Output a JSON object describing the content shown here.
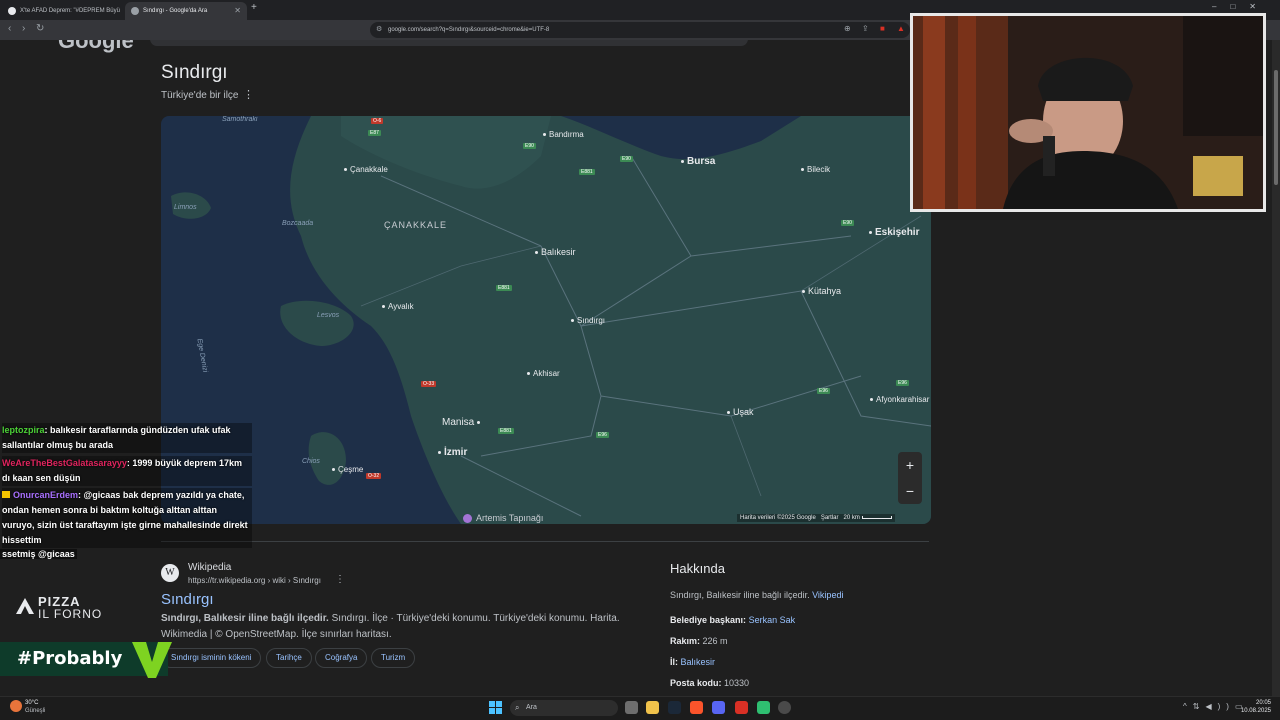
{
  "browser": {
    "tabs": [
      {
        "label": "X'te AFAD Deprem: \"#DEPREM Büyü",
        "active": false
      },
      {
        "label": "Sındırgı - Google'da Ara",
        "active": true
      }
    ],
    "new_tab": "+",
    "url": "google.com/search?q=Sındırgı&sourceid=chrome&ie=UTF-8"
  },
  "page": {
    "logo_text": "Google",
    "knowledge_panel": {
      "title": "Sındırgı",
      "subtitle": "Türkiye'de bir ilçe"
    },
    "map": {
      "cities": [
        "Bandırma",
        "Bursa",
        "Bilecik",
        "Çanakkale",
        "Balıkesir",
        "Eskişehir",
        "Ayvalık",
        "Sındırgı",
        "Kütahya",
        "Akhisar",
        "Manisa",
        "İzmir",
        "Uşak",
        "Afyonkarahisar",
        "Çeşme",
        "Artemis Tapınağı"
      ],
      "regions": [
        "ÇANAKKALE"
      ],
      "seas": [
        "Samothraki",
        "Limnos",
        "Bozcaada",
        "Lesvos",
        "Ege Denizi",
        "Chios"
      ],
      "roads": [
        "O-6",
        "E87",
        "E90",
        "E90",
        "E881",
        "E90",
        "E881",
        "O-33",
        "E881",
        "E96",
        "E96",
        "E96",
        "O-32"
      ],
      "attribution": "Harita verileri ©2025 Google",
      "terms": "Şartlar",
      "scale": "20 km",
      "zoom_in": "+",
      "zoom_out": "−"
    },
    "result": {
      "site_name": "Wikipedia",
      "url": "https://tr.wikipedia.org › wiki › Sındırgı",
      "title": "Sındırgı",
      "snippet_bold": "Sındırgı, Balıkesir iline bağlı ilçedir.",
      "snippet_rest": " Sındırgı. İlçe · Türkiye'deki konumu. Türkiye'deki konumu. Harita. Wikimedia | © OpenStreetMap. İlçe sınırları haritası.",
      "chips": [
        "Sındırgı isminin kökeni",
        "Tarihçe",
        "Coğrafya",
        "Turizm"
      ]
    },
    "about": {
      "title": "Hakkında",
      "description": "Sındırgı, Balıkesir iline bağlı ilçedir.",
      "description_link": "Vikipedi",
      "facts": [
        {
          "label": "Belediye başkanı:",
          "value": "Serkan Sak",
          "link": true
        },
        {
          "label": "Rakım:",
          "value": "226 m",
          "link": false
        },
        {
          "label": "İl:",
          "value": "Balıkesir",
          "link": true
        },
        {
          "label": "Posta kodu:",
          "value": "10330",
          "link": false
        }
      ]
    }
  },
  "overlay": {
    "chat": [
      {
        "user": "leptozpira",
        "user_color": "#4cd137",
        "text": ": balıkesir taraflarında gündüzden ufak ufak sallantılar olmuş bu arada"
      },
      {
        "user": "WeAreTheBestGalatasarayyy",
        "user_color": "#e0245e",
        "text": ": 1999 büyük deprem 17km dı kaan sen düşün"
      },
      {
        "user": "OnurcanErdem",
        "user_color": "#a970ff",
        "text": ": @gicaas bak deprem yazıldı ya chate, ondan hemen sonra bi baktım koltuğa alttan alttan vuruyo, sizin üst taraftayım işte girne mahallesinde direkt hissettim"
      }
    ],
    "chat_truncated": "ssetmiş @gicaas",
    "pizza_line1": "PIZZA",
    "pizza_line2": "IL FORNO",
    "probably": "#Probably"
  },
  "taskbar": {
    "weather_temp": "30°C",
    "weather_cond": "Güneşli",
    "search_placeholder": "Ara",
    "time": "20:05",
    "date": "10.08.2025"
  },
  "colors": {
    "link": "#99c3ff",
    "map_water": "#1e2f48",
    "map_land": "#2b4a4a",
    "probably_green": "#7ed321"
  }
}
